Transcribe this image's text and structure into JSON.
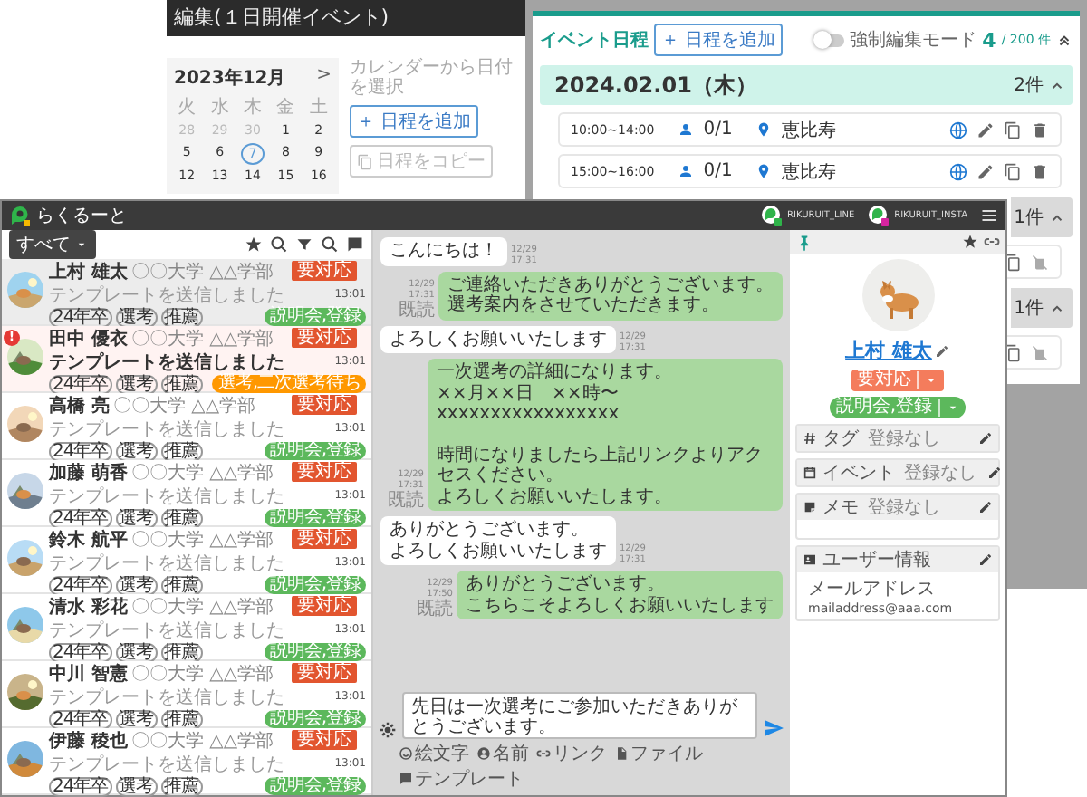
{
  "event_editor": {
    "title": "編集(１日開催イベント)",
    "calendar": {
      "month": "2023年12月",
      "next": ">",
      "weekdays": [
        "火",
        "水",
        "木",
        "金",
        "土"
      ],
      "weeks": [
        [
          {
            "day": "28",
            "other_month": true,
            "selected": false
          },
          {
            "day": "29",
            "other_month": true,
            "selected": false
          },
          {
            "day": "30",
            "other_month": true,
            "selected": false
          },
          {
            "day": "1",
            "other_month": false,
            "selected": false
          },
          {
            "day": "2",
            "other_month": false,
            "selected": false
          }
        ],
        [
          {
            "day": "5",
            "other_month": false,
            "selected": false
          },
          {
            "day": "6",
            "other_month": false,
            "selected": false
          },
          {
            "day": "7",
            "other_month": false,
            "selected": true
          },
          {
            "day": "8",
            "other_month": false,
            "selected": false
          },
          {
            "day": "9",
            "other_month": false,
            "selected": false
          }
        ],
        [
          {
            "day": "12",
            "other_month": false,
            "selected": false
          },
          {
            "day": "13",
            "other_month": false,
            "selected": false
          },
          {
            "day": "14",
            "other_month": false,
            "selected": false
          },
          {
            "day": "15",
            "other_month": false,
            "selected": false
          },
          {
            "day": "16",
            "other_month": false,
            "selected": false
          }
        ]
      ]
    },
    "hint": "カレンダーから日付を選択",
    "add_button": "＋ 日程を追加",
    "copy_button": {
      "label": "日程をコピー",
      "disabled": true
    }
  },
  "schedule": {
    "title": "イベント日程",
    "add_button": "＋ 日程を追加",
    "force_edit": {
      "label": "強制編集モード",
      "on": false
    },
    "count": "4",
    "limit": "/ 200 件",
    "groups": [
      {
        "date": "2024.02.01（木）",
        "count": "2件",
        "selected": true,
        "rows": [
          {
            "time": "10:00~14:00",
            "capacity": "0/1",
            "place": "恵比寿",
            "editable": true
          },
          {
            "time": "15:00~16:00",
            "capacity": "0/1",
            "place": "恵比寿",
            "editable": true
          }
        ]
      },
      {
        "count": "1件",
        "selected": false,
        "rows": [
          {
            "editable": false
          }
        ]
      },
      {
        "count": "1件",
        "selected": false,
        "rows": [
          {
            "editable": false
          }
        ]
      }
    ]
  },
  "app": {
    "logo": "らくるーと",
    "accounts": [
      {
        "name": "RIKURUIT_LINE",
        "color": "#2fb44a"
      },
      {
        "name": "RIKURUIT_INSTA",
        "color": "#d6249f"
      }
    ]
  },
  "filter": {
    "label": "すべて"
  },
  "contacts": [
    {
      "name": "上村 雄太",
      "school": "〇〇大学 △△学部",
      "last": "テンプレートを送信しました",
      "time": "13:01",
      "status": "要対応",
      "tags": [
        "24年卒",
        "選考",
        "推薦"
      ],
      "stage": {
        "label": "説明会,登録",
        "color": "#5cb85c"
      },
      "selected": true,
      "unread": false
    },
    {
      "name": "田中 優衣",
      "school": "〇〇大学 △△学部",
      "last": "テンプレートを送信しました",
      "time": "13:01",
      "status": "要対応",
      "tags": [
        "24年卒",
        "選考",
        "推薦"
      ],
      "stage": {
        "label": "選考,二次選考待ち",
        "color": "#ff9800"
      },
      "selected": false,
      "unread": true,
      "badge": "!"
    },
    {
      "name": "高橋 亮",
      "school": "〇〇大学 △△学部",
      "last": "テンプレートを送信しました",
      "time": "13:01",
      "status": "要対応",
      "tags": [
        "24年卒",
        "選考",
        "推薦"
      ],
      "stage": {
        "label": "説明会,登録",
        "color": "#5cb85c"
      },
      "selected": false,
      "unread": false
    },
    {
      "name": "加藤 萌香",
      "school": "〇〇大学 △△学部",
      "last": "テンプレートを送信しました",
      "time": "13:01",
      "status": "要対応",
      "tags": [
        "24年卒",
        "選考",
        "推薦"
      ],
      "stage": {
        "label": "説明会,登録",
        "color": "#5cb85c"
      },
      "selected": false,
      "unread": false
    },
    {
      "name": "鈴木 航平",
      "school": "〇〇大学 △△学部",
      "last": "テンプレートを送信しました",
      "time": "13:01",
      "status": "要対応",
      "tags": [
        "24年卒",
        "選考",
        "推薦"
      ],
      "stage": {
        "label": "説明会,登録",
        "color": "#5cb85c"
      },
      "selected": false,
      "unread": false
    },
    {
      "name": "清水 彩花",
      "school": "〇〇大学 △△学部",
      "last": "テンプレートを送信しました",
      "time": "13:01",
      "status": "要対応",
      "tags": [
        "24年卒",
        "選考",
        "推薦"
      ],
      "stage": {
        "label": "説明会,登録",
        "color": "#5cb85c"
      },
      "selected": false,
      "unread": false
    },
    {
      "name": "中川 智憲",
      "school": "〇〇大学 △△学部",
      "last": "テンプレートを送信しました",
      "time": "13:01",
      "status": "要対応",
      "tags": [
        "24年卒",
        "選考",
        "推薦"
      ],
      "stage": {
        "label": "説明会,登録",
        "color": "#5cb85c"
      },
      "selected": false,
      "unread": false
    },
    {
      "name": "伊藤 稜也",
      "school": "〇〇大学 △△学部",
      "last": "テンプレートを送信しました",
      "time": "13:01",
      "status": "要対応",
      "tags": [
        "24年卒",
        "選考",
        "推薦"
      ],
      "stage": {
        "label": "説明会,登録",
        "color": "#5cb85c"
      },
      "selected": false,
      "unread": false
    }
  ],
  "chat": {
    "messages": [
      {
        "kind": "received",
        "lines": [
          "こんにちは！"
        ],
        "date": "12/29",
        "time": "17:31"
      },
      {
        "kind": "sent",
        "lines": [
          "ご連絡いただきありがとうございます。",
          "選考案内をさせていただきます。"
        ],
        "date": "12/29",
        "time": "17:31",
        "read": "既読"
      },
      {
        "kind": "received",
        "lines": [
          "よろしくお願いいたします"
        ],
        "date": "12/29",
        "time": "17:31"
      },
      {
        "kind": "sent",
        "lines": [
          "一次選考の詳細になります。",
          "××月××日　××時〜",
          "xxxxxxxxxxxxxxxxx",
          "時間になりましたら上記リンクよりアクセスください。",
          "よろしくお願いいたします。"
        ],
        "date": "12/29",
        "time": "17:31",
        "read": "既読"
      },
      {
        "kind": "received",
        "lines": [
          "ありがとうございます。",
          "よろしくお願いいたします"
        ],
        "date": "12/29",
        "time": "17:31"
      },
      {
        "kind": "sent",
        "lines": [
          "ありがとうございます。",
          "こちらこそよろしくお願いいたします"
        ],
        "date": "12/29",
        "time": "17:50",
        "read": "既読"
      }
    ],
    "composer": {
      "value": "先日は一次選考にご参加いただきありがとうございます。",
      "tools": [
        {
          "kind": "emoji",
          "label": "絵文字"
        },
        {
          "kind": "name",
          "label": "名前"
        },
        {
          "kind": "link",
          "label": "リンク"
        },
        {
          "kind": "file",
          "label": "ファイル"
        },
        {
          "kind": "template",
          "label": "テンプレート"
        }
      ]
    }
  },
  "profile": {
    "name": "上村 雄太",
    "status": "要対応",
    "stage": "説明会,登録",
    "sections": [
      {
        "kind": "tag",
        "label": "タグ",
        "value": "登録なし"
      },
      {
        "kind": "event",
        "label": "イベント",
        "value": "登録なし"
      },
      {
        "kind": "memo",
        "label": "メモ",
        "value": "登録なし"
      }
    ],
    "user_info": {
      "title": "ユーザー情報",
      "fields": [
        {
          "label": "メールアドレス",
          "value": "mailaddress@aaa.com"
        }
      ]
    }
  }
}
